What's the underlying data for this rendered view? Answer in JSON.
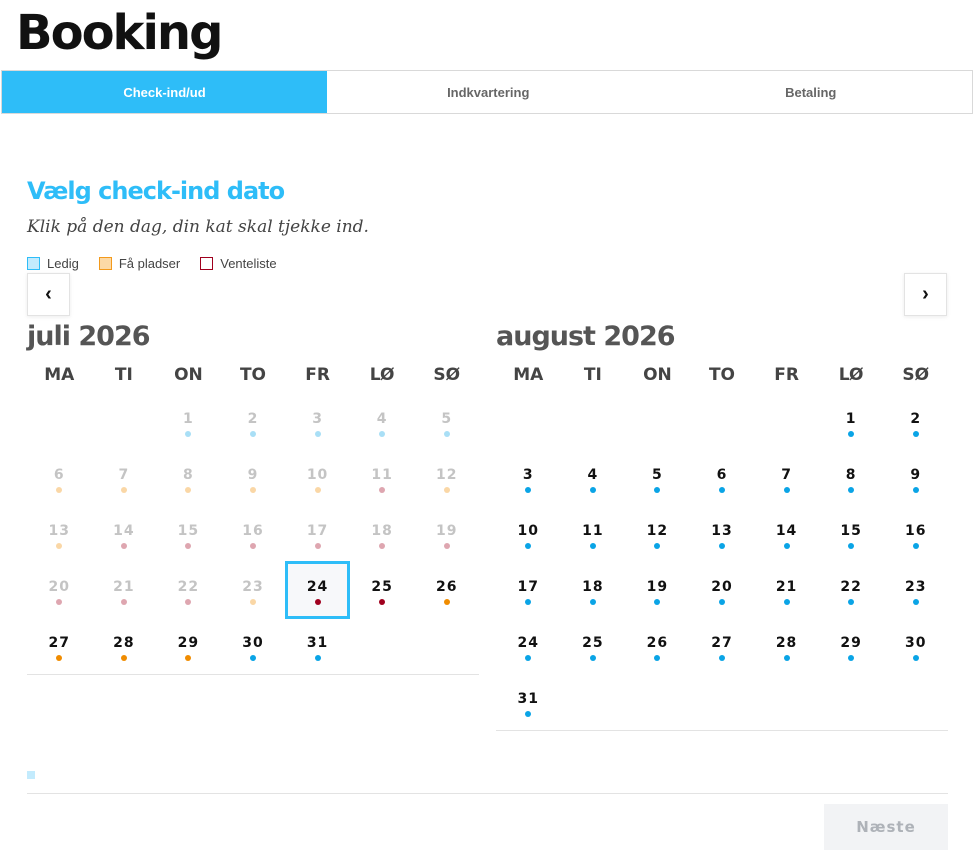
{
  "page": {
    "title": "Booking"
  },
  "steps": [
    {
      "label": "Check-ind/ud",
      "active": true
    },
    {
      "label": "Indkvartering",
      "active": false
    },
    {
      "label": "Betaling",
      "active": false
    }
  ],
  "content": {
    "heading": "Vælg check-ind dato",
    "subtitle": "Klik på den dag, din kat skal tjekke ind."
  },
  "legend": [
    {
      "label": "Ledig",
      "color": "#2ebdf8",
      "fill": "#c3ebfd"
    },
    {
      "label": "Få pladser",
      "color": "#f39a1c",
      "fill": "#fcd9a6"
    },
    {
      "label": "Venteliste",
      "color": "#a0001e",
      "fill": "#ffffff"
    }
  ],
  "colors": {
    "available": "#0aa4e6",
    "few": "#f08c00",
    "waitlist": "#a0001e",
    "accent": "#2ebdf8"
  },
  "nav": {
    "prev_icon": "‹",
    "next_icon": "›"
  },
  "weekdays": [
    "MA",
    "TI",
    "ON",
    "TO",
    "FR",
    "LØ",
    "SØ"
  ],
  "months": [
    {
      "title": "juli 2026",
      "offset": 2,
      "days": [
        {
          "n": "1",
          "s": "available",
          "past": true
        },
        {
          "n": "2",
          "s": "available",
          "past": true
        },
        {
          "n": "3",
          "s": "available",
          "past": true
        },
        {
          "n": "4",
          "s": "available",
          "past": true
        },
        {
          "n": "5",
          "s": "available",
          "past": true
        },
        {
          "n": "6",
          "s": "few",
          "past": true
        },
        {
          "n": "7",
          "s": "few",
          "past": true
        },
        {
          "n": "8",
          "s": "few",
          "past": true
        },
        {
          "n": "9",
          "s": "few",
          "past": true
        },
        {
          "n": "10",
          "s": "few",
          "past": true
        },
        {
          "n": "11",
          "s": "waitlist",
          "past": true
        },
        {
          "n": "12",
          "s": "few",
          "past": true
        },
        {
          "n": "13",
          "s": "few",
          "past": true
        },
        {
          "n": "14",
          "s": "waitlist",
          "past": true
        },
        {
          "n": "15",
          "s": "waitlist",
          "past": true
        },
        {
          "n": "16",
          "s": "waitlist",
          "past": true
        },
        {
          "n": "17",
          "s": "waitlist",
          "past": true
        },
        {
          "n": "18",
          "s": "waitlist",
          "past": true
        },
        {
          "n": "19",
          "s": "waitlist",
          "past": true
        },
        {
          "n": "20",
          "s": "waitlist",
          "past": true
        },
        {
          "n": "21",
          "s": "waitlist",
          "past": true
        },
        {
          "n": "22",
          "s": "waitlist",
          "past": true
        },
        {
          "n": "23",
          "s": "few",
          "past": true
        },
        {
          "n": "24",
          "s": "waitlist",
          "past": false,
          "selected": true
        },
        {
          "n": "25",
          "s": "waitlist",
          "past": false
        },
        {
          "n": "26",
          "s": "few",
          "past": false
        },
        {
          "n": "27",
          "s": "few",
          "past": false
        },
        {
          "n": "28",
          "s": "few",
          "past": false
        },
        {
          "n": "29",
          "s": "few",
          "past": false
        },
        {
          "n": "30",
          "s": "available",
          "past": false
        },
        {
          "n": "31",
          "s": "available",
          "past": false
        }
      ]
    },
    {
      "title": "august 2026",
      "offset": 5,
      "days": [
        {
          "n": "1",
          "s": "available"
        },
        {
          "n": "2",
          "s": "available"
        },
        {
          "n": "3",
          "s": "available"
        },
        {
          "n": "4",
          "s": "available"
        },
        {
          "n": "5",
          "s": "available"
        },
        {
          "n": "6",
          "s": "available"
        },
        {
          "n": "7",
          "s": "available"
        },
        {
          "n": "8",
          "s": "available"
        },
        {
          "n": "9",
          "s": "available"
        },
        {
          "n": "10",
          "s": "available"
        },
        {
          "n": "11",
          "s": "available"
        },
        {
          "n": "12",
          "s": "available"
        },
        {
          "n": "13",
          "s": "available"
        },
        {
          "n": "14",
          "s": "available"
        },
        {
          "n": "15",
          "s": "available"
        },
        {
          "n": "16",
          "s": "available"
        },
        {
          "n": "17",
          "s": "available"
        },
        {
          "n": "18",
          "s": "available"
        },
        {
          "n": "19",
          "s": "available"
        },
        {
          "n": "20",
          "s": "available"
        },
        {
          "n": "21",
          "s": "available"
        },
        {
          "n": "22",
          "s": "available"
        },
        {
          "n": "23",
          "s": "available"
        },
        {
          "n": "24",
          "s": "available"
        },
        {
          "n": "25",
          "s": "available"
        },
        {
          "n": "26",
          "s": "available"
        },
        {
          "n": "27",
          "s": "available"
        },
        {
          "n": "28",
          "s": "available"
        },
        {
          "n": "29",
          "s": "available"
        },
        {
          "n": "30",
          "s": "available"
        },
        {
          "n": "31",
          "s": "available"
        }
      ]
    }
  ],
  "footer": {
    "next_label": "Næste"
  }
}
